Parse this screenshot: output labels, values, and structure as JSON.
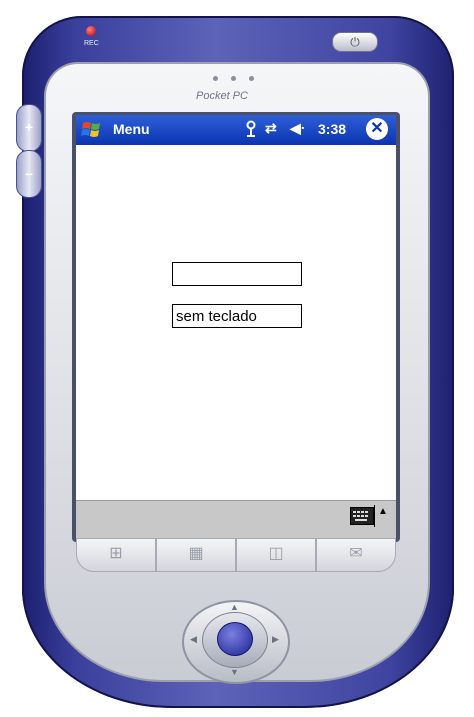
{
  "device": {
    "brand": "Pocket PC",
    "rec_label": "REC",
    "volume_up": "+",
    "volume_down": "–"
  },
  "taskbar": {
    "title": "Menu",
    "clock": "3:38",
    "icons": [
      "connectivity-icon",
      "sync-arrows-icon",
      "speaker-icon",
      "close-icon"
    ],
    "accent": "#0a35b0"
  },
  "form": {
    "field1": {
      "value": ""
    },
    "field2": {
      "value": "sem teclado"
    }
  },
  "hardware_buttons": [
    "start-icon",
    "calendar-icon",
    "contacts-icon",
    "inbox-icon"
  ]
}
